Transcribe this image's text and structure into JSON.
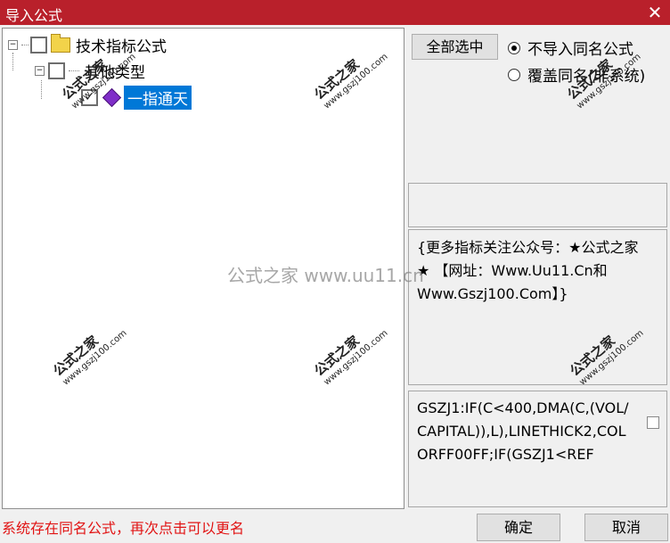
{
  "window": {
    "title": "导入公式",
    "close": "✕"
  },
  "tree": {
    "root": {
      "label": "技术指标公式",
      "expander": "−"
    },
    "group": {
      "label": "其他类型",
      "expander": "−"
    },
    "item": {
      "label": "一指通天",
      "check": "✓"
    }
  },
  "options": {
    "select_all": "全部选中",
    "radio_no_import": "不导入同名公式",
    "radio_overwrite": "覆盖同名(非系统)"
  },
  "info_text": "{更多指标关注公众号：★公式之家★ 【网址：Www.Uu11.Cn和Www.Gszj100.Com】}",
  "code_text": "GSZJ1:IF(C<400,DMA(C,(VOL/CAPITAL)),L),LINETHICK2,COLORFF00FF;IF(GSZJ1<REF",
  "status": "系统存在同名公式，再次点击可以更名",
  "buttons": {
    "ok": "确定",
    "cancel": "取消"
  },
  "watermarks": {
    "brand": "公式之家",
    "url": "www.gszj100.com",
    "center": "公式之家 www.uu11.cn"
  }
}
